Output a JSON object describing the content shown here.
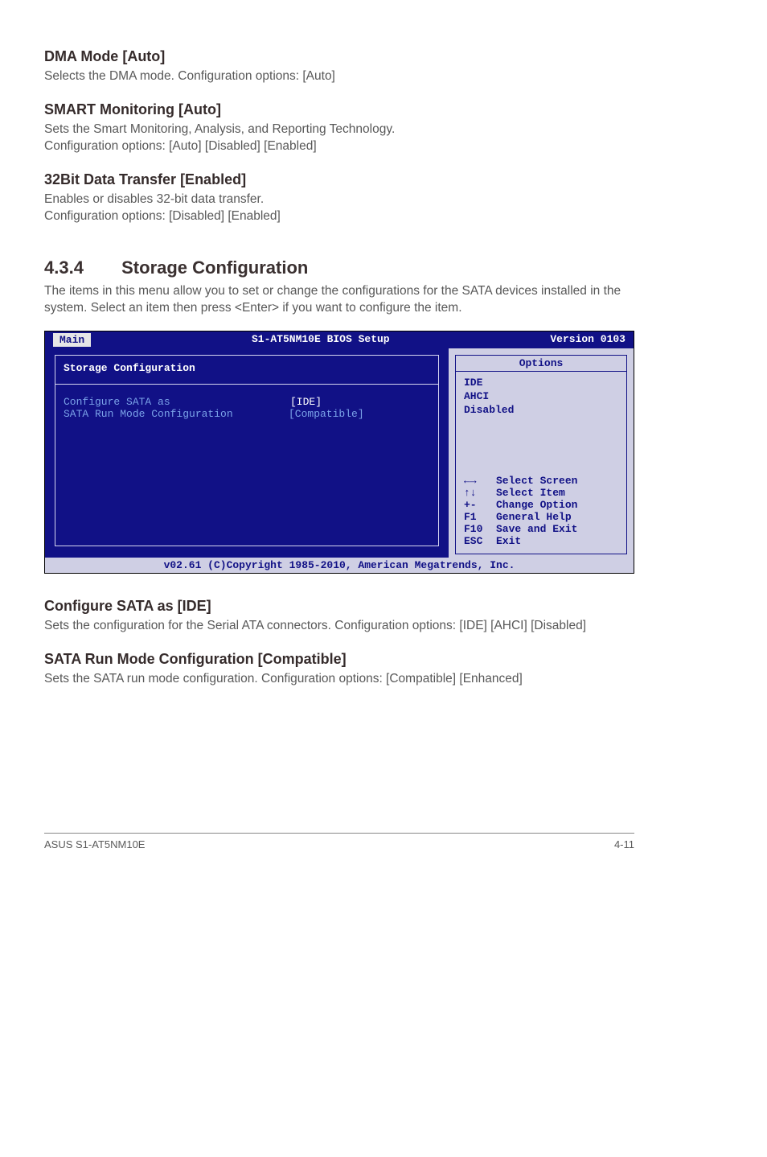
{
  "sections": {
    "dma": {
      "heading": "DMA Mode [Auto]",
      "body": "Selects the DMA mode. Configuration options: [Auto]"
    },
    "smart": {
      "heading": "SMART Monitoring [Auto]",
      "body1": "Sets the Smart Monitoring, Analysis, and Reporting Technology.",
      "body2": "Configuration options: [Auto] [Disabled] [Enabled]"
    },
    "bit32": {
      "heading": "32Bit Data Transfer [Enabled]",
      "body1": "Enables or disables 32-bit data transfer.",
      "body2": "Configuration options: [Disabled] [Enabled]"
    }
  },
  "storageSection": {
    "number": "4.3.4",
    "title": "Storage Configuration",
    "intro": "The items in this menu allow you to set or change the configurations for the SATA devices installed in the system. Select an item then press <Enter> if you want to configure the item."
  },
  "bios": {
    "title_center": "S1-AT5NM10E BIOS Setup",
    "version": "Version 0103",
    "tab": "Main",
    "box_title": "Storage Configuration",
    "rows": [
      {
        "label": "Configure SATA as",
        "value": "[IDE]"
      },
      {
        "label": "SATA Run Mode Configuration",
        "value": "[Compatible]"
      }
    ],
    "right": {
      "options_label": "Options",
      "modes": [
        "IDE",
        "AHCI",
        "Disabled"
      ],
      "keys": [
        {
          "sym": "←→",
          "desc": "Select Screen"
        },
        {
          "sym": "↑↓",
          "desc": "Select Item"
        },
        {
          "sym": "+-",
          "desc": "Change Option"
        },
        {
          "sym": "F1",
          "desc": "General Help"
        },
        {
          "sym": "F10",
          "desc": "Save and Exit"
        },
        {
          "sym": "ESC",
          "desc": "Exit"
        }
      ]
    },
    "footer": "v02.61 (C)Copyright 1985-2010, American Megatrends, Inc."
  },
  "configSata": {
    "heading": "Configure SATA as [IDE]",
    "body": "Sets the configuration for the Serial ATA connectors. Configuration options: [IDE] [AHCI] [Disabled]"
  },
  "sataRun": {
    "heading": "SATA Run Mode Configuration [Compatible]",
    "body": "Sets the SATA run mode configuration. Configuration options: [Compatible] [Enhanced]"
  },
  "footer": {
    "left": "ASUS S1-AT5NM10E",
    "right": "4-11"
  }
}
